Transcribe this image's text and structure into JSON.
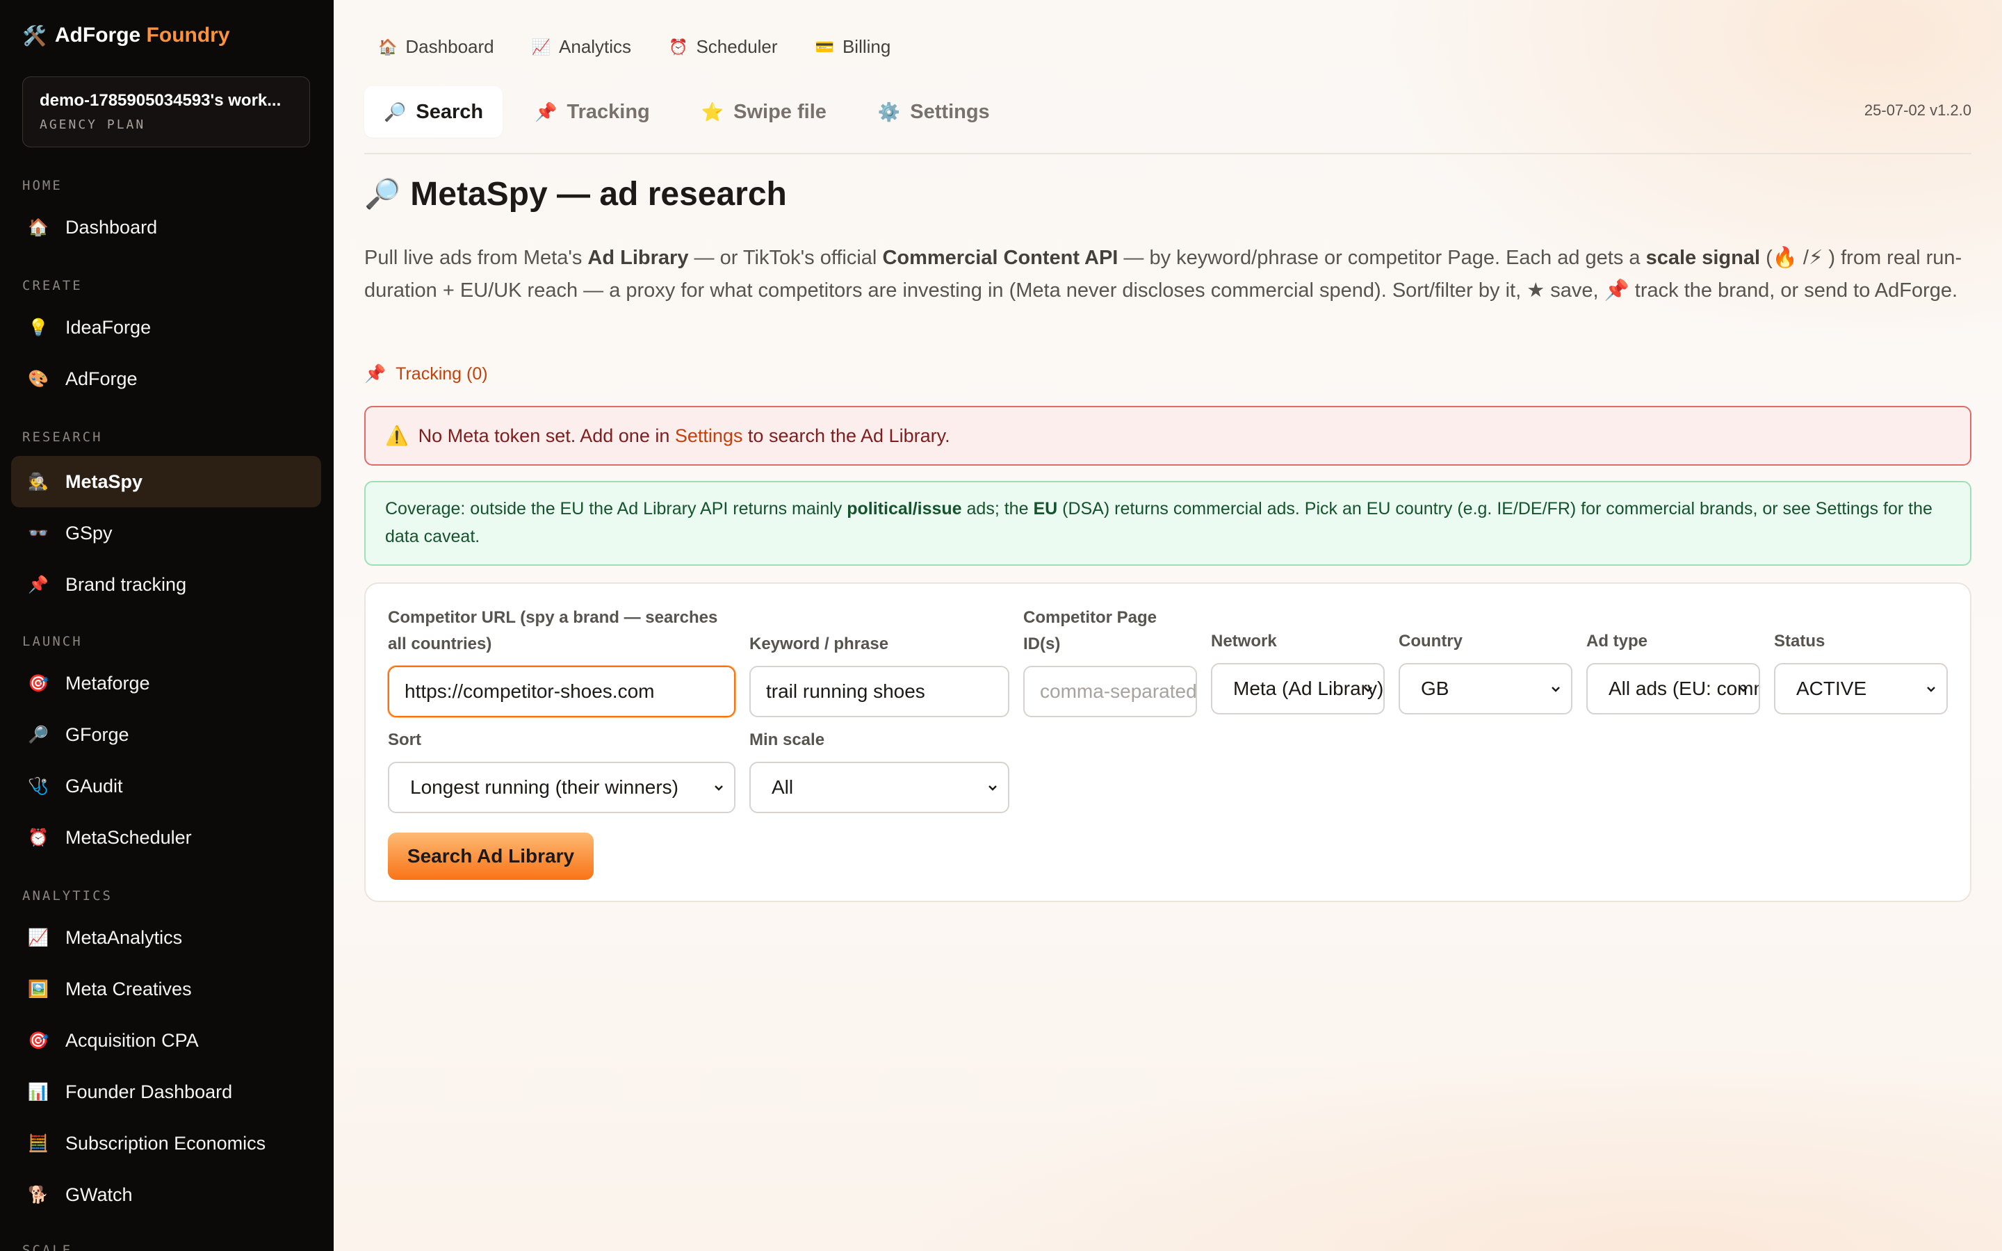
{
  "sidebar": {
    "brand_main": "AdForge",
    "brand_accent": "Foundry",
    "brand_icon": "🛠️",
    "workspace_name": "demo-1785905034593's work...",
    "workspace_plan": "AGENCY PLAN",
    "sections": {
      "home": "HOME",
      "create": "CREATE",
      "research": "RESEARCH",
      "launch": "LAUNCH",
      "analytics": "ANALYTICS",
      "scale": "SCALE"
    },
    "items": [
      {
        "label": "Dashboard",
        "icon": "🏠"
      },
      {
        "label": "IdeaForge",
        "icon": "💡"
      },
      {
        "label": "AdForge",
        "icon": "🎨"
      },
      {
        "label": "MetaSpy",
        "icon": "🕵️"
      },
      {
        "label": "GSpy",
        "icon": "👓"
      },
      {
        "label": "Brand tracking",
        "icon": "📌"
      },
      {
        "label": "Metaforge",
        "icon": "🎯"
      },
      {
        "label": "GForge",
        "icon": "🔎"
      },
      {
        "label": "GAudit",
        "icon": "🩺"
      },
      {
        "label": "MetaScheduler",
        "icon": "⏰"
      },
      {
        "label": "MetaAnalytics",
        "icon": "📈"
      },
      {
        "label": "Meta Creatives",
        "icon": "🖼️"
      },
      {
        "label": "Acquisition CPA",
        "icon": "🎯"
      },
      {
        "label": "Founder Dashboard",
        "icon": "📊"
      },
      {
        "label": "Subscription Economics",
        "icon": "🧮"
      },
      {
        "label": "GWatch",
        "icon": "🐕"
      }
    ]
  },
  "topnav": [
    {
      "label": "Dashboard",
      "icon": "🏠"
    },
    {
      "label": "Analytics",
      "icon": "📈"
    },
    {
      "label": "Scheduler",
      "icon": "⏰"
    },
    {
      "label": "Billing",
      "icon": "💳"
    }
  ],
  "tabs": [
    {
      "label": "Search",
      "icon": "🔎"
    },
    {
      "label": "Tracking",
      "icon": "📌"
    },
    {
      "label": "Swipe file",
      "icon": "⭐"
    },
    {
      "label": "Settings",
      "icon": "⚙️"
    }
  ],
  "version": "25-07-02 v1.2.0",
  "page": {
    "title": "MetaSpy — ad research",
    "title_icon": "🔎",
    "intro": {
      "p1": "Pull live ads from Meta's ",
      "b1": "Ad Library",
      "p2": " — or TikTok's official ",
      "b2": "Commercial Content API",
      "p3": " — by keyword/phrase or competitor Page. Each ad gets a ",
      "b3": "scale signal",
      "p4": " (🔥 /⚡ ) from real run-duration + EU/UK reach — a proxy for what competitors are investing in (Meta never discloses commercial spend). Sort/filter by it, ★ save, 📌  track the brand, or send to AdForge."
    },
    "tracking_icon": "📌",
    "tracking_label": "Tracking (0)"
  },
  "alerts": {
    "token_icon": "⚠️",
    "token_before": "No Meta token set. Add one in ",
    "token_link": "Settings",
    "token_after": " to search the Ad Library.",
    "coverage_p1": "Coverage: outside the EU the Ad Library API returns mainly ",
    "coverage_b1": "political/issue",
    "coverage_p2": " ads; the ",
    "coverage_b2": "EU",
    "coverage_p3": " (DSA) returns commercial ads. Pick an EU country (e.g. IE/DE/FR) for commercial brands, or see Settings for the data caveat."
  },
  "form": {
    "competitor_url_label": "Competitor URL (spy a brand — searches all countries)",
    "competitor_url_value": "https://competitor-shoes.com",
    "keyword_label": "Keyword / phrase",
    "keyword_value": "trail running shoes",
    "page_ids_label": "Competitor Page ID(s)",
    "page_ids_placeholder": "comma-separated",
    "network_label": "Network",
    "network_value": "Meta (Ad Library)",
    "country_label": "Country",
    "country_value": "GB",
    "ad_type_label": "Ad type",
    "ad_type_value": "All ads (EU: commercial)",
    "status_label": "Status",
    "status_value": "ACTIVE",
    "sort_label": "Sort",
    "sort_value": "Longest running (their winners)",
    "min_scale_label": "Min scale",
    "min_scale_value": "All",
    "submit_label": "Search Ad Library"
  },
  "colors": {
    "accent": "#f97316",
    "sidebar_bg": "#0c0a09",
    "active_nav_bg": "#2c1f14",
    "alert_red_border": "#e06a6a",
    "alert_green_border": "#9ee0b5"
  }
}
